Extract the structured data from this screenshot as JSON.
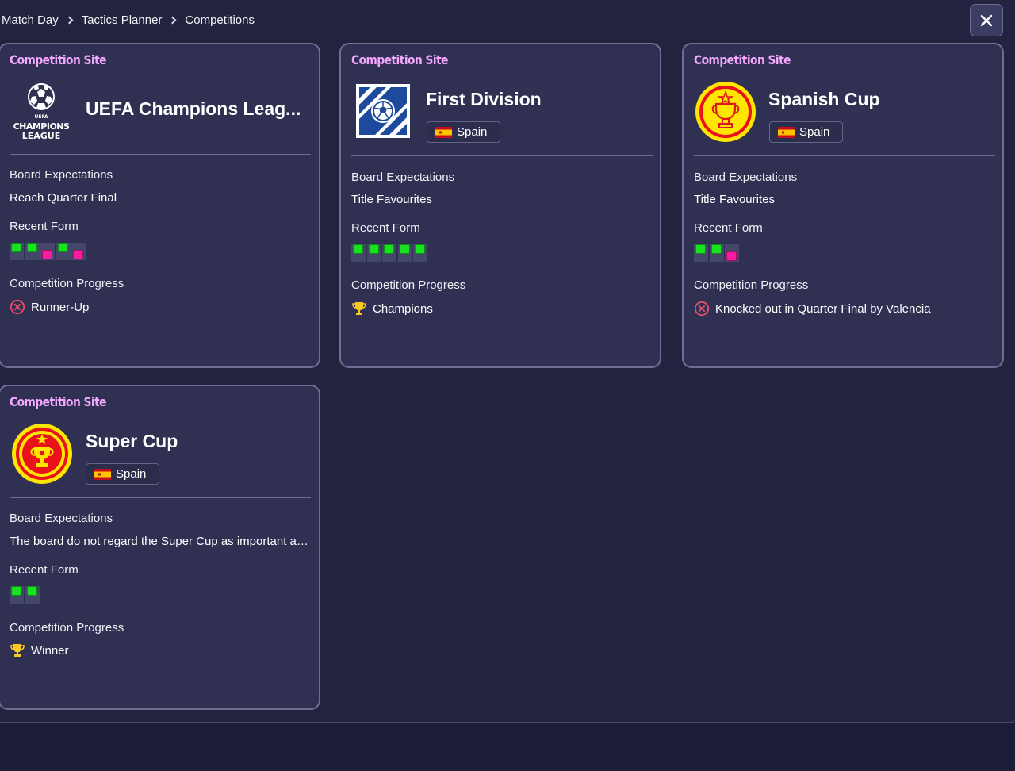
{
  "breadcrumb": [
    "Match Day",
    "Tactics Planner",
    "Competitions"
  ],
  "icons": {
    "close": "close-icon",
    "chevron": "chevron-right-icon",
    "eliminated": "x-circle-icon",
    "trophy": "trophy-icon"
  },
  "colors": {
    "win": "#19e321",
    "loss": "#ff1aa2",
    "accent": "#f5a8ff",
    "trophy": "#f9c922",
    "eliminated": "#ee4d6c"
  },
  "labels": {
    "site": "Competition Site",
    "board": "Board Expectations",
    "form": "Recent Form",
    "progress": "Competition Progress"
  },
  "cards": [
    {
      "name": "UEFA Champions Leag...",
      "logo_text": [
        "UEFA",
        "CHAMPIONS",
        "LEAGUE"
      ],
      "nation": "",
      "board": "Reach Quarter Final",
      "form": [
        "W",
        "W",
        "L",
        "W",
        "L"
      ],
      "progress": "Runner-Up",
      "progress_icon": "x-circle-icon"
    },
    {
      "name": "First Division",
      "nation": "Spain",
      "board": "Title Favourites",
      "form": [
        "W",
        "W",
        "W",
        "W",
        "W"
      ],
      "progress": "Champions",
      "progress_icon": "trophy-icon"
    },
    {
      "name": "Spanish Cup",
      "nation": "Spain",
      "board": "Title Favourites",
      "form": [
        "W",
        "W",
        "L"
      ],
      "progress": "Knocked out in Quarter Final by Valencia",
      "progress_icon": "x-circle-icon"
    },
    {
      "name": "Super Cup",
      "nation": "Spain",
      "board": "The board do not regard the Super Cup as important an...",
      "form": [
        "W",
        "W"
      ],
      "progress": "Winner",
      "progress_icon": "trophy-icon"
    }
  ]
}
